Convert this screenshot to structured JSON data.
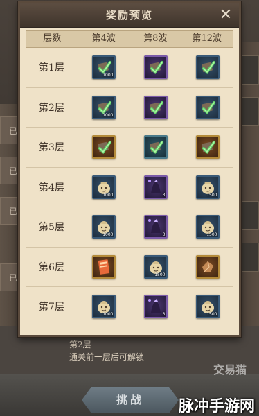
{
  "modal": {
    "title": "奖励预览",
    "close_glyph": "✕"
  },
  "table": {
    "headers": [
      "层数",
      "第4波",
      "第8波",
      "第12波"
    ],
    "rows": [
      {
        "label": "第1层",
        "cells": [
          {
            "icon": "green-feather-scroll-icon",
            "frame": "blue",
            "qty": "1000"
          },
          {
            "icon": "green-feather-scroll-icon",
            "frame": "purple",
            "qty": ""
          },
          {
            "icon": "green-feather-scroll-icon",
            "frame": "blue",
            "qty": ""
          }
        ]
      },
      {
        "label": "第2层",
        "cells": [
          {
            "icon": "green-feather-scroll-icon",
            "frame": "blue",
            "qty": "1000"
          },
          {
            "icon": "green-feather-scroll-icon",
            "frame": "purple",
            "qty": ""
          },
          {
            "icon": "green-feather-scroll-icon",
            "frame": "blue",
            "qty": ""
          }
        ]
      },
      {
        "label": "第3层",
        "cells": [
          {
            "icon": "green-feather-scroll-icon",
            "frame": "gold",
            "qty": ""
          },
          {
            "icon": "green-feather-scroll-icon",
            "frame": "teal",
            "qty": ""
          },
          {
            "icon": "green-feather-scroll-icon",
            "frame": "gold",
            "qty": ""
          }
        ]
      },
      {
        "label": "第4层",
        "cells": [
          {
            "icon": "coin-bag-icon",
            "frame": "blue",
            "qty": "1000"
          },
          {
            "icon": "purple-ninja-icon",
            "frame": "purple",
            "qty": "3"
          },
          {
            "icon": "coin-bag-icon",
            "frame": "blue",
            "qty": "1500"
          }
        ]
      },
      {
        "label": "第5层",
        "cells": [
          {
            "icon": "coin-bag-icon",
            "frame": "blue",
            "qty": "1000"
          },
          {
            "icon": "purple-ninja-icon",
            "frame": "purple",
            "qty": "3"
          },
          {
            "icon": "coin-bag-icon",
            "frame": "blue",
            "qty": "1500"
          }
        ]
      },
      {
        "label": "第6层",
        "cells": [
          {
            "icon": "red-ticket-icon",
            "frame": "gold",
            "qty": ""
          },
          {
            "icon": "coin-bag-icon",
            "frame": "blue",
            "qty": "1500"
          },
          {
            "icon": "bronze-gem-icon",
            "frame": "gold",
            "qty": ""
          }
        ]
      },
      {
        "label": "第7层",
        "cells": [
          {
            "icon": "coin-bag-icon",
            "frame": "blue",
            "qty": "1000"
          },
          {
            "icon": "purple-ninja-icon",
            "frame": "purple",
            "qty": "3"
          },
          {
            "icon": "coin-bag-icon",
            "frame": "blue",
            "qty": "1500"
          }
        ]
      }
    ]
  },
  "background": {
    "left_tabs": [
      "已",
      "已",
      "已",
      "已"
    ],
    "bottom_line_1": "第2层",
    "bottom_line_2": "通关前一层后可解锁",
    "challenge_label": "挑战"
  },
  "watermark": {
    "logo": "交易猫",
    "text": "脉冲手游网"
  },
  "colors": {
    "modal_bg": "#efe2c8",
    "header_bg": "#4a3d33",
    "blue_frame": "#3a5a78",
    "purple_frame": "#7a5aa8",
    "gold_frame": "#b48b3a"
  }
}
